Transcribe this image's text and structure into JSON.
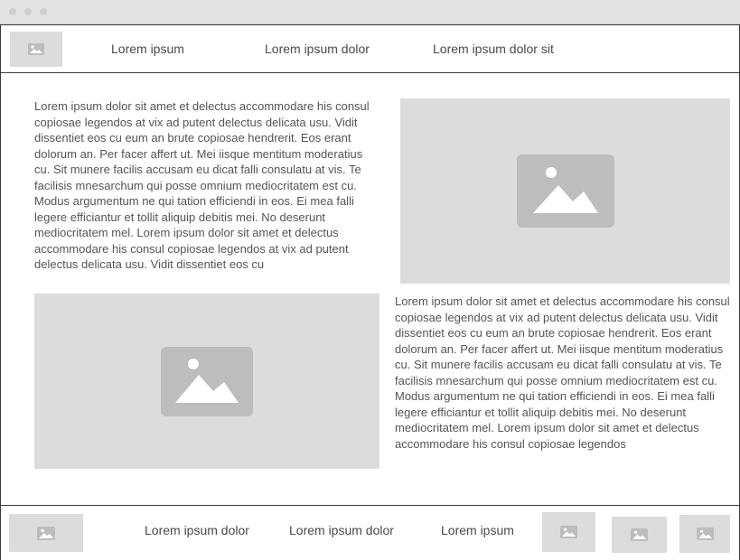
{
  "header": {
    "links": [
      "Lorem ipsum",
      "Lorem ipsum dolor",
      "Lorem ipsum dolor sit"
    ]
  },
  "main": {
    "paragraph_1": "Lorem ipsum dolor sit amet et delectus accommodare his consul copiosae legendos at vix ad putent delectus delicata usu. Vidit dissentiet eos cu eum an brute copiosae hendrerit. Eos erant dolorum an. Per facer affert ut. Mei iisque mentitum moderatius cu. Sit munere facilis accusam eu dicat falli consulatu at vis. Te facilisis mnesarchum qui posse omnium mediocritatem est cu. Modus argumentum ne qui tation efficiendi in eos. Ei mea falli legere efficiantur et tollit aliquip debitis mei. No deserunt mediocritatem mel. Lorem ipsum dolor sit amet et delectus accommodare his consul copiosae legendos at vix ad putent delectus delicata usu. Vidit dissentiet eos cu",
    "paragraph_2": "Lorem ipsum dolor sit amet et delectus accommodare his consul copiosae legendos at vix ad putent delectus delicata usu. Vidit dissentiet eos cu eum an brute copiosae hendrerit. Eos erant dolorum an. Per facer affert ut. Mei iisque mentitum moderatius cu. Sit munere facilis accusam eu dicat falli consulatu at vis. Te facilisis mnesarchum qui posse omnium mediocritatem est cu. Modus argumentum ne qui tation efficiendi in eos. Ei mea falli legere efficiantur et tollit aliquip debitis mei. No deserunt mediocritatem mel. Lorem ipsum dolor sit amet et delectus accommodare his consul copiosae legendos"
  },
  "footer": {
    "links": [
      "Lorem ipsum dolor",
      "Lorem ipsum dolor",
      "Lorem ipsum"
    ]
  },
  "icons": {
    "placeholder": "image-placeholder-icon"
  },
  "colors": {
    "placeholder_bg": "#dcdcdc",
    "placeholder_icon": "#bdbdbd",
    "border": "#3a3a3a"
  }
}
